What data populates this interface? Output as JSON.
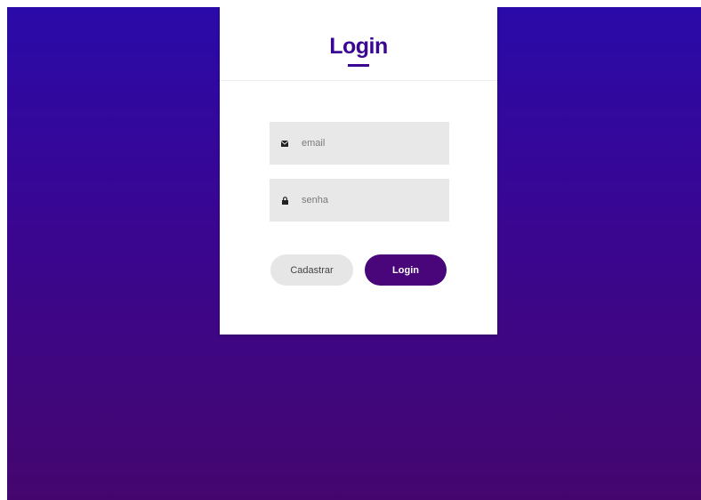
{
  "card": {
    "title": "Login"
  },
  "form": {
    "email_placeholder": "email",
    "email_value": "",
    "password_placeholder": "senha",
    "password_value": ""
  },
  "buttons": {
    "register_label": "Cadastrar",
    "login_label": "Login"
  },
  "icons": {
    "email": "envelope-icon",
    "password": "lock-icon"
  },
  "colors": {
    "accent": "#3a0794",
    "primary_button": "#48067a",
    "background_top": "#2a0aa8",
    "background_bottom": "#44066e"
  }
}
